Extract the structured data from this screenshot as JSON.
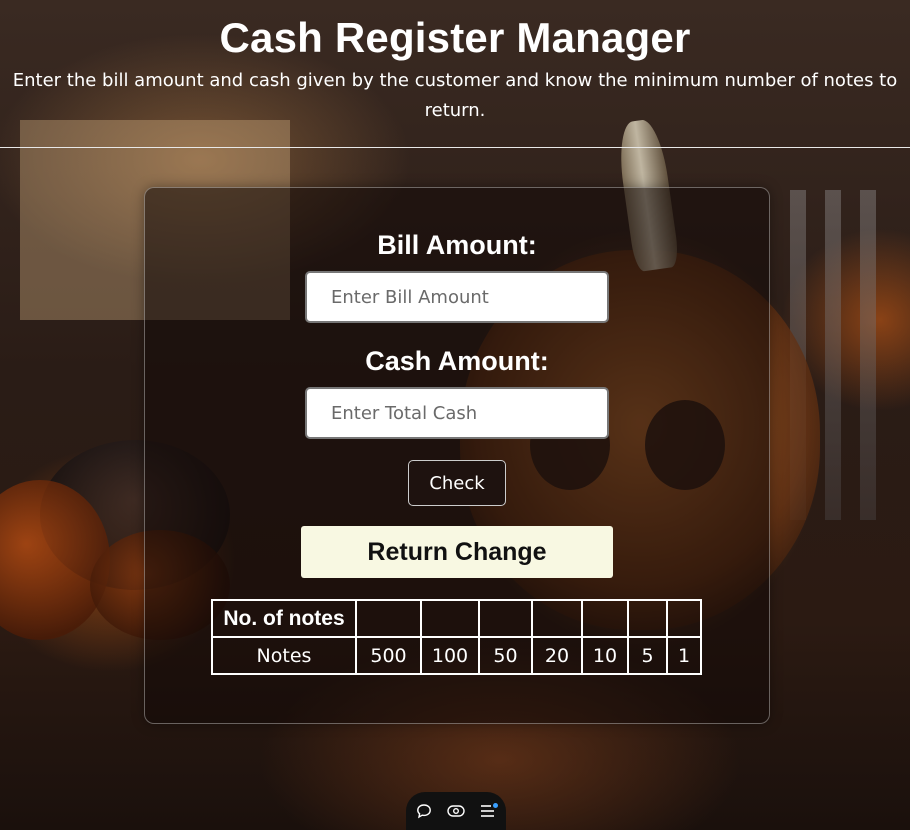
{
  "header": {
    "title": "Cash Register Manager",
    "subtitle": "Enter the bill amount and cash given by the customer and know the minimum number of notes to return."
  },
  "form": {
    "bill_label": "Bill Amount:",
    "bill_placeholder": "Enter Bill Amount",
    "bill_value": "",
    "cash_label": "Cash Amount:",
    "cash_placeholder": "Enter Total Cash",
    "cash_value": "",
    "check_button": "Check",
    "return_label": "Return Change"
  },
  "notes_table": {
    "row1_header": "No. of notes",
    "row1_values": [
      "",
      "",
      "",
      "",
      "",
      "",
      ""
    ],
    "row2_header": "Notes",
    "denominations": [
      "500",
      "100",
      "50",
      "20",
      "10",
      "5",
      "1"
    ]
  },
  "toolbar": {
    "icons": [
      "comment-icon",
      "eye-icon",
      "menu-icon"
    ]
  },
  "colors": {
    "return_box_bg": "#f8f8e2",
    "card_bg": "rgba(18,10,8,0.55)",
    "toolbar_bg": "#111111",
    "notification_dot": "#3aa0ff"
  }
}
